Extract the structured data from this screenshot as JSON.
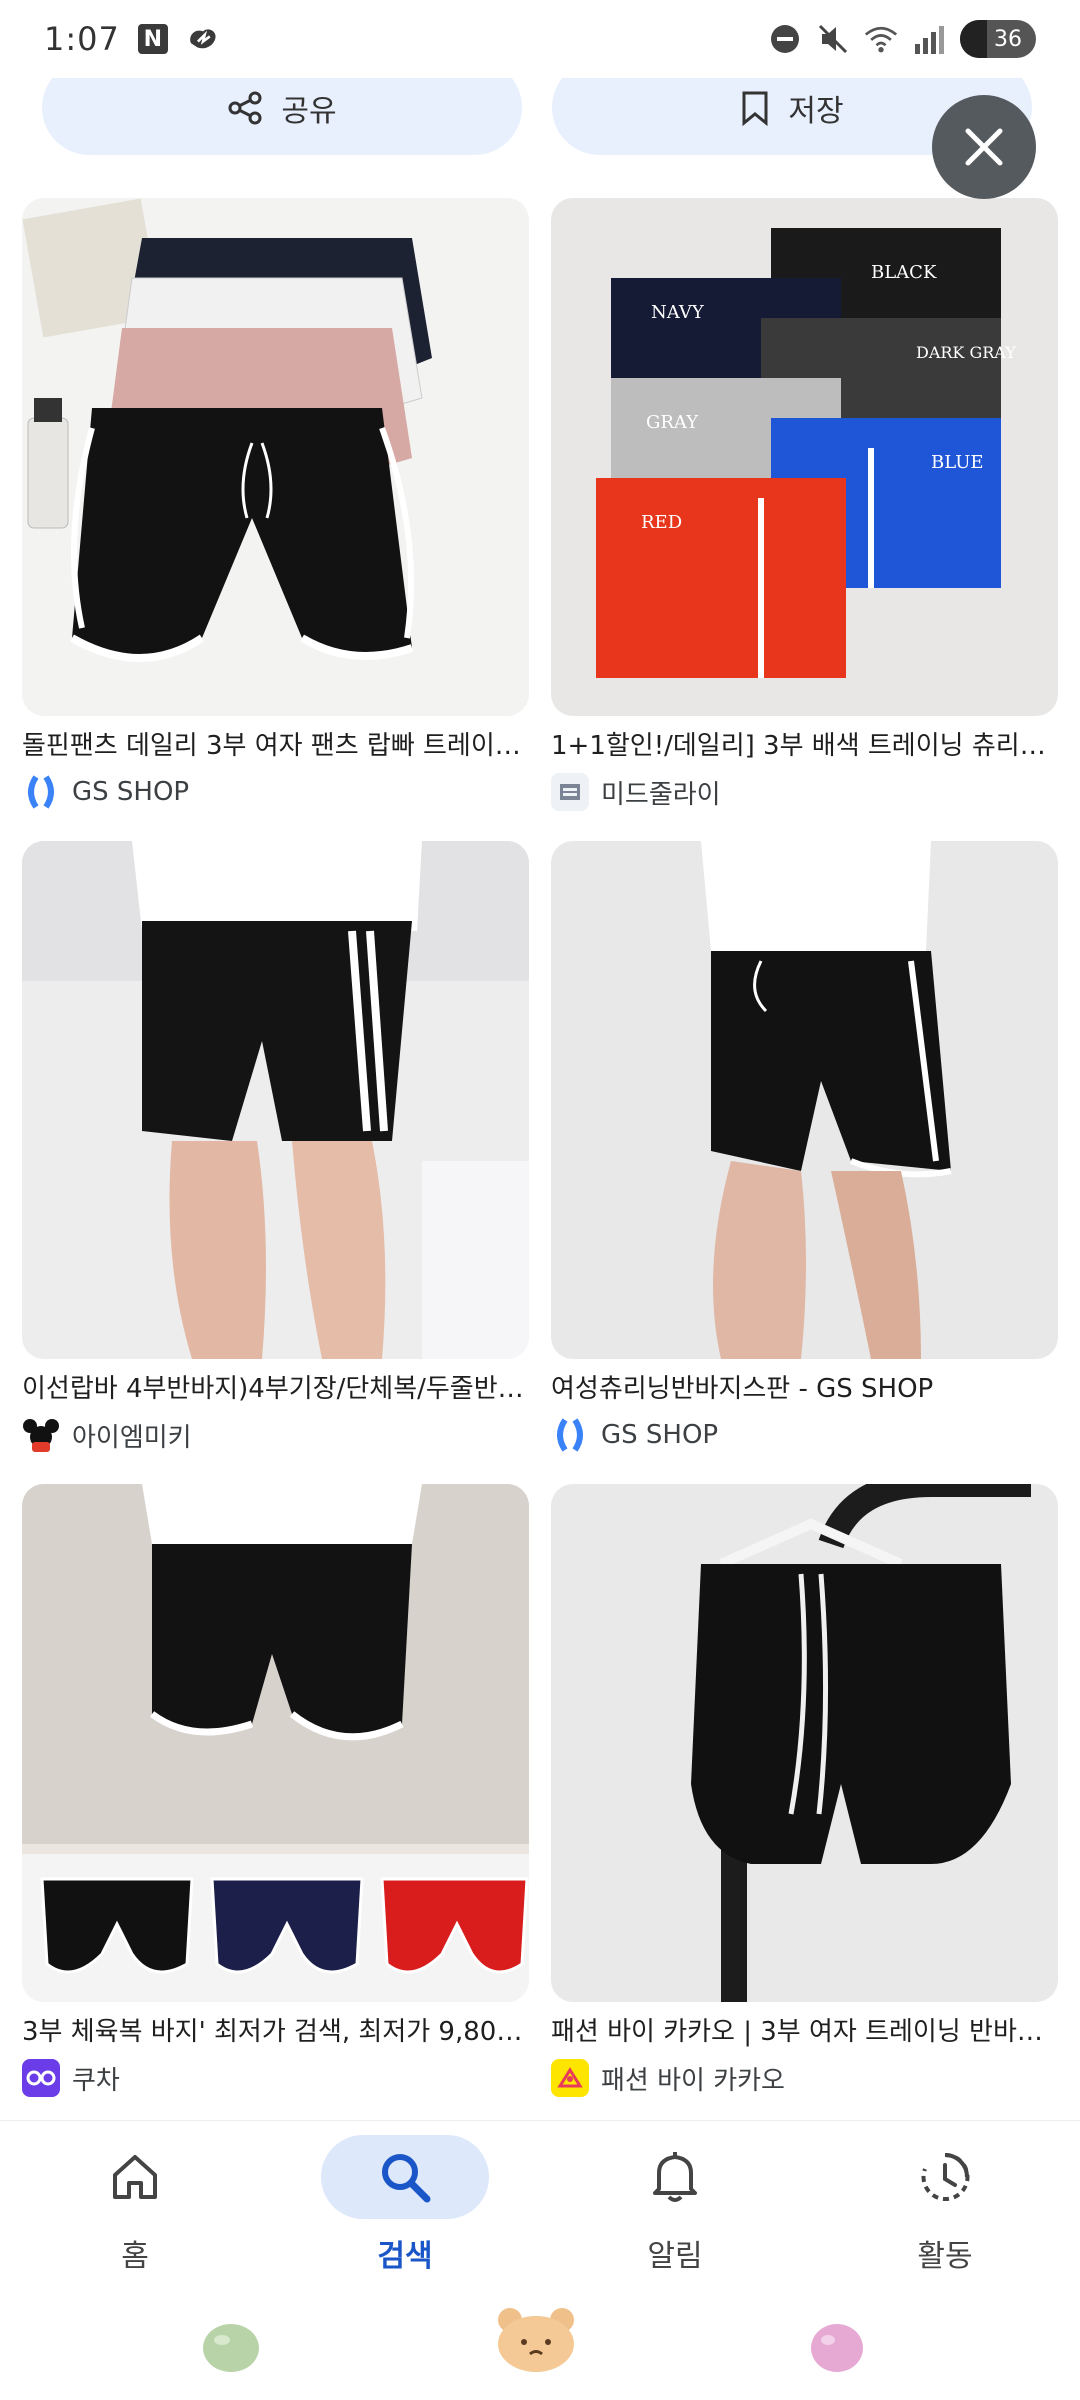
{
  "status_bar": {
    "time": "1:07",
    "battery": "36",
    "battery_level": 0.36
  },
  "top_actions": {
    "share_label": "공유",
    "save_label": "저장"
  },
  "results": [
    {
      "title": "돌핀팬츠 데일리 3부 여자 팬츠 랍빠 트레이…",
      "source": "GS SHOP",
      "source_icon": "gs-shop-logo-icon"
    },
    {
      "title": "1+1할인!/데일리] 3부 배색 트레이닝 츄리닝 …",
      "source": "미드줄라이",
      "source_icon": "store-logo-icon"
    },
    {
      "title": "이선랍바 4부반바지)4부기장/단체복/두줄반…",
      "source": "아이엠미키",
      "source_icon": "mickey-logo-icon"
    },
    {
      "title": "여성츄리닝반바지스판 - GS SHOP",
      "source": "GS SHOP",
      "source_icon": "gs-shop-logo-icon"
    },
    {
      "title": "3부 체육복 바지' 최저가 검색, 최저가 9,800…",
      "source": "쿠차",
      "source_icon": "coocha-logo-icon"
    },
    {
      "title": "패션 바이 카카오 | 3부 여자 트레이닝 반바지…",
      "source": "패션 바이 카카오",
      "source_icon": "kakao-fashion-logo-icon"
    }
  ],
  "image_labels": {
    "red": "RED",
    "gray": "GRAY",
    "navy": "NAVY",
    "black": "BLACK",
    "dark_gray": "DARK GRAY",
    "blue": "BLUE"
  },
  "bottom_nav": [
    {
      "label": "홈",
      "icon": "home-icon",
      "active": false
    },
    {
      "label": "검색",
      "icon": "search-icon",
      "active": true
    },
    {
      "label": "알림",
      "icon": "bell-icon",
      "active": false
    },
    {
      "label": "활동",
      "icon": "activity-icon",
      "active": false
    }
  ],
  "colors": {
    "accent": "#1a56c7",
    "pill_bg": "#e8f0fe",
    "nav_active_bg": "#dde8fb"
  }
}
